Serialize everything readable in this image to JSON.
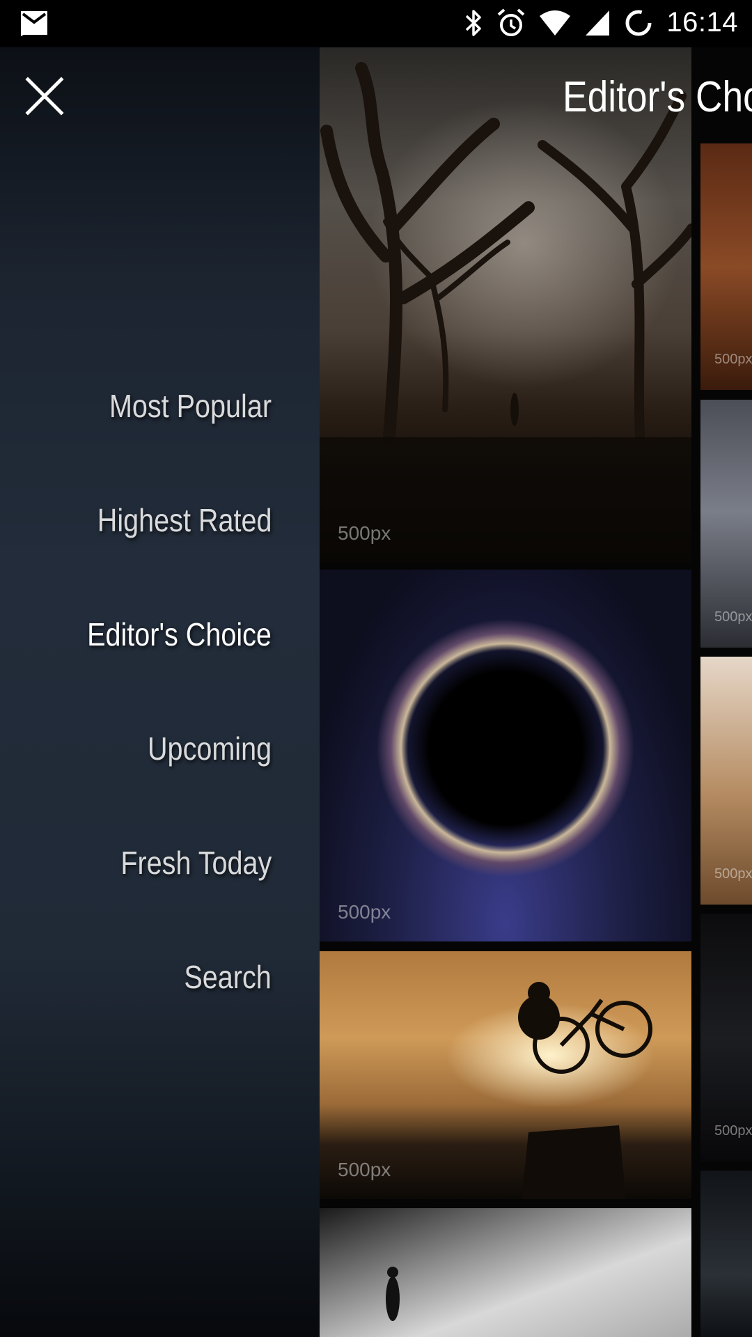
{
  "status_bar": {
    "time": "16:14",
    "icons": [
      "mail-icon",
      "bluetooth-icon",
      "alarm-icon",
      "wifi-icon",
      "cell-signal-icon",
      "sync-icon"
    ]
  },
  "drawer": {
    "close_icon": "close-icon",
    "menu_items": [
      {
        "label": "Most Popular",
        "active": false
      },
      {
        "label": "Highest Rated",
        "active": false
      },
      {
        "label": "Editor's Choice",
        "active": true
      },
      {
        "label": "Upcoming",
        "active": false
      },
      {
        "label": "Fresh Today",
        "active": false
      },
      {
        "label": "Search",
        "active": false
      }
    ]
  },
  "content": {
    "title": "Editor's Cho",
    "watermark": "500px",
    "colors": {
      "text_primary": "#ffffff",
      "text_menu": "#d9dadc"
    }
  }
}
